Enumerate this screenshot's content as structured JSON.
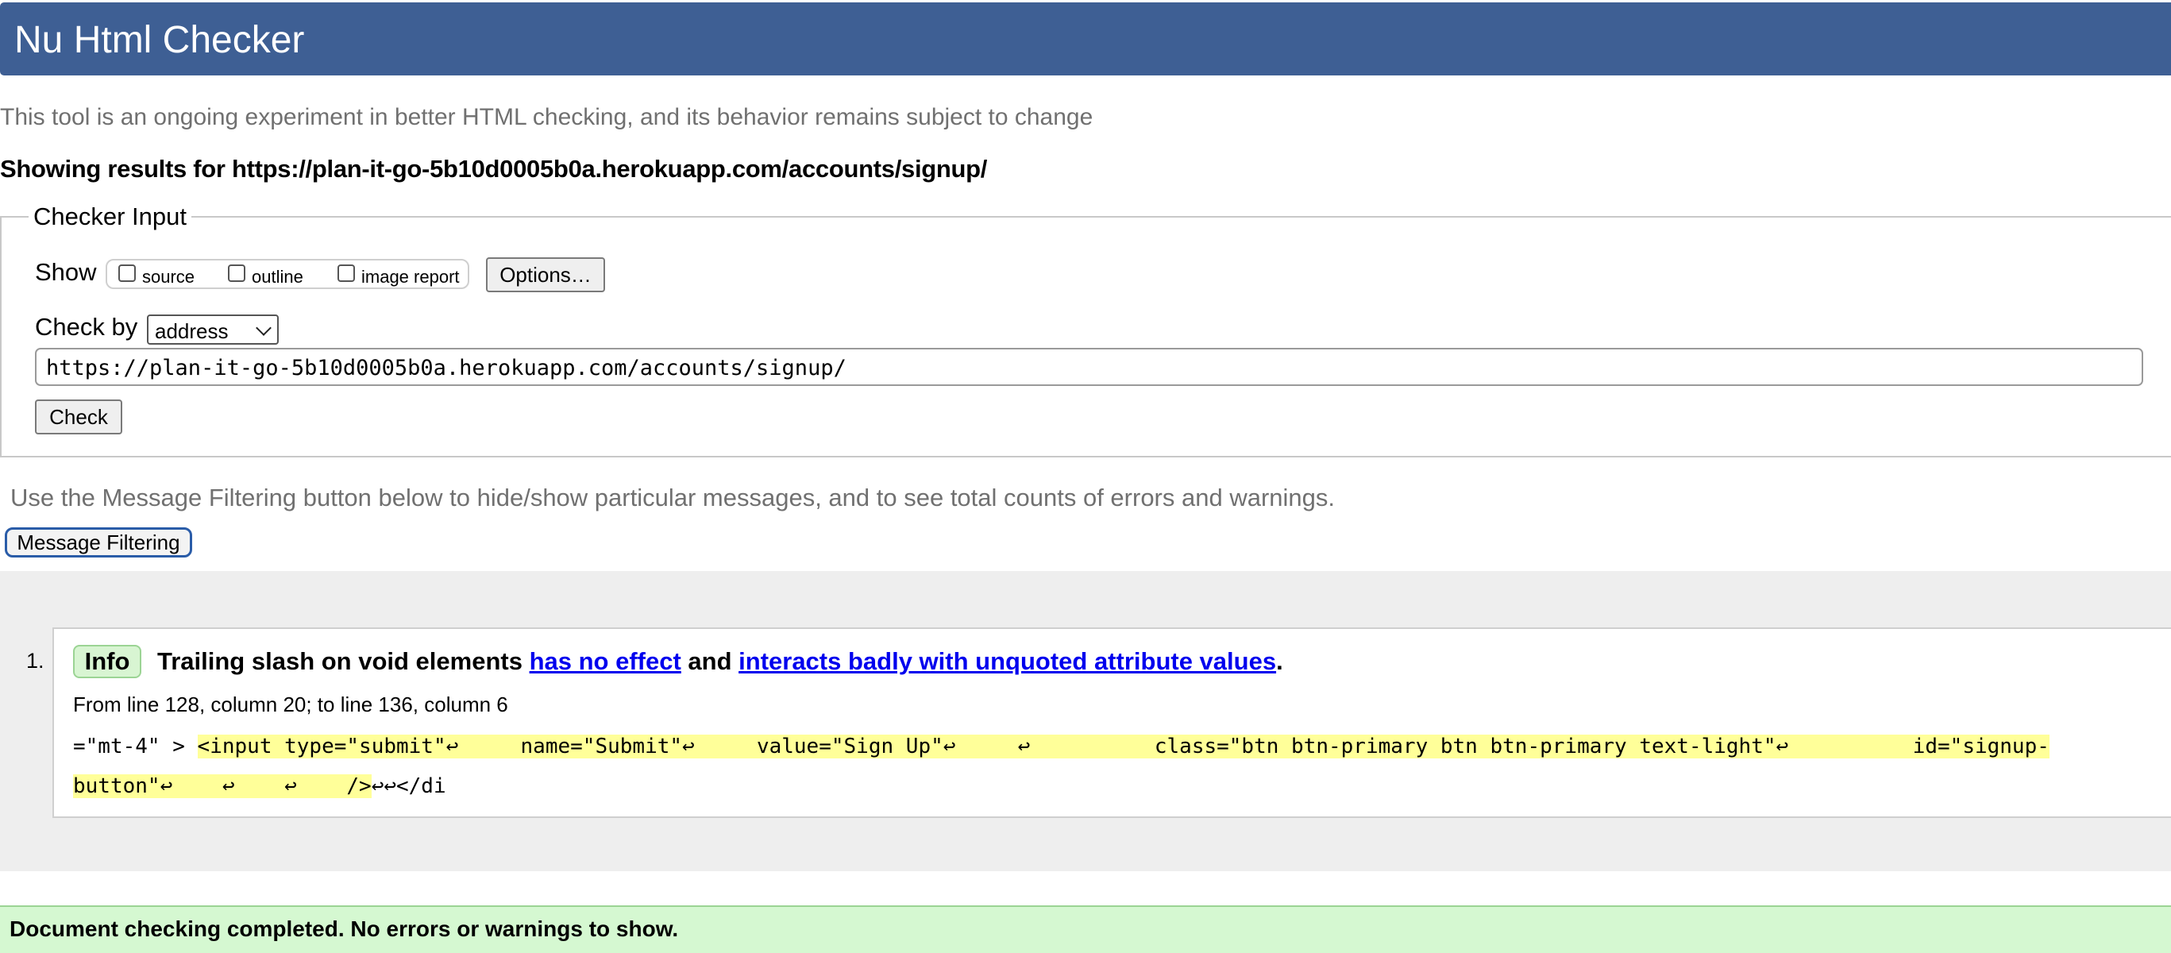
{
  "header": {
    "title": "Nu Html Checker"
  },
  "intro_text": "This tool is an ongoing experiment in better HTML checking, and its behavior remains subject to change",
  "results_heading": "Showing results for https://plan-it-go-5b10d0005b0a.herokuapp.com/accounts/signup/",
  "checker_input": {
    "legend": "Checker Input",
    "show_label": "Show",
    "show_options": [
      {
        "label": "source",
        "checked": false
      },
      {
        "label": "outline",
        "checked": false
      },
      {
        "label": "image report",
        "checked": false
      }
    ],
    "options_button": "Options…",
    "check_by_label": "Check by",
    "check_by_value": "address",
    "url_value": "https://plan-it-go-5b10d0005b0a.herokuapp.com/accounts/signup/",
    "check_button": "Check"
  },
  "filtering": {
    "text": "Use the Message Filtering button below to hide/show particular messages, and to see total counts of errors and warnings.",
    "button": "Message Filtering"
  },
  "messages": [
    {
      "number": "1.",
      "type": "Info",
      "text_part1": "Trailing slash on void elements ",
      "link1": "has no effect",
      "text_part2": " and ",
      "link2": "interacts badly with unquoted attribute values",
      "text_part3": ".",
      "location": "From line 128, column 20; to line 136, column 6",
      "extract_prefix": "=\"mt-4\" > ",
      "extract_line1_highlight": "<input type=\"submit\"↩     name=\"Submit\"↩     value=\"Sign Up\"↩     ↩          class=\"btn btn-primary btn btn-primary text-light\"↩          id=\"signup-",
      "extract_line2_highlight": "button\"↩    ↩    ↩    />",
      "extract_suffix": "↩↩</di"
    }
  ],
  "status": {
    "text": "Document checking completed. No errors or warnings to show."
  },
  "colors": {
    "header_bg": "#3e5f94",
    "info_badge_bg": "#d8f5d2",
    "highlight": "#ffff99",
    "success_bar": "#d5f8d1",
    "link": "#0000ee"
  }
}
